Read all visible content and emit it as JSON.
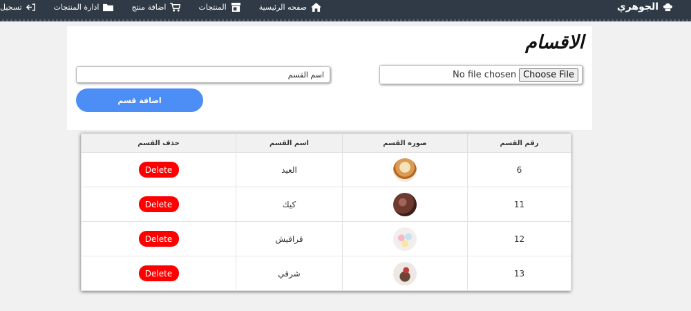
{
  "brand": {
    "name": "الجوهري",
    "icon": "chef-hat-icon"
  },
  "nav": [
    {
      "key": "home",
      "label": "صفحه الرئيسية",
      "icon": "home-icon"
    },
    {
      "key": "products",
      "label": "المنتجات",
      "icon": "store-icon"
    },
    {
      "key": "add_product",
      "label": "اضافة منتج",
      "icon": "cart-icon"
    },
    {
      "key": "manage",
      "label": "ادارة المنتجات",
      "icon": "folder-icon"
    },
    {
      "key": "logout",
      "label": "تسجيل خروج",
      "icon": "sign-out-icon"
    }
  ],
  "page": {
    "title": "الاقسام"
  },
  "form": {
    "name_placeholder": "اسم القسم",
    "file_button": "Choose File",
    "file_status": "No file chosen",
    "submit_label": "اضافة قسم"
  },
  "table": {
    "headers": [
      "رقم القسم",
      "صوره القسم",
      "اسم القسم",
      "حذف القسم"
    ],
    "rows": [
      {
        "id": "6",
        "name": "العيد",
        "image": "cake-thumbnail",
        "action": "Delete"
      },
      {
        "id": "11",
        "name": "كيك",
        "image": "chocolate-cake-thumbnail",
        "action": "Delete"
      },
      {
        "id": "12",
        "name": "قراقيش",
        "image": "macarons-thumbnail",
        "action": "Delete"
      },
      {
        "id": "13",
        "name": "شرقي",
        "image": "oriental-sweets-thumbnail",
        "action": "Delete"
      }
    ]
  },
  "colors": {
    "nav_bg": "#2f3a46",
    "accent_blue": "#4c8df6",
    "delete_red": "#ff0000"
  }
}
